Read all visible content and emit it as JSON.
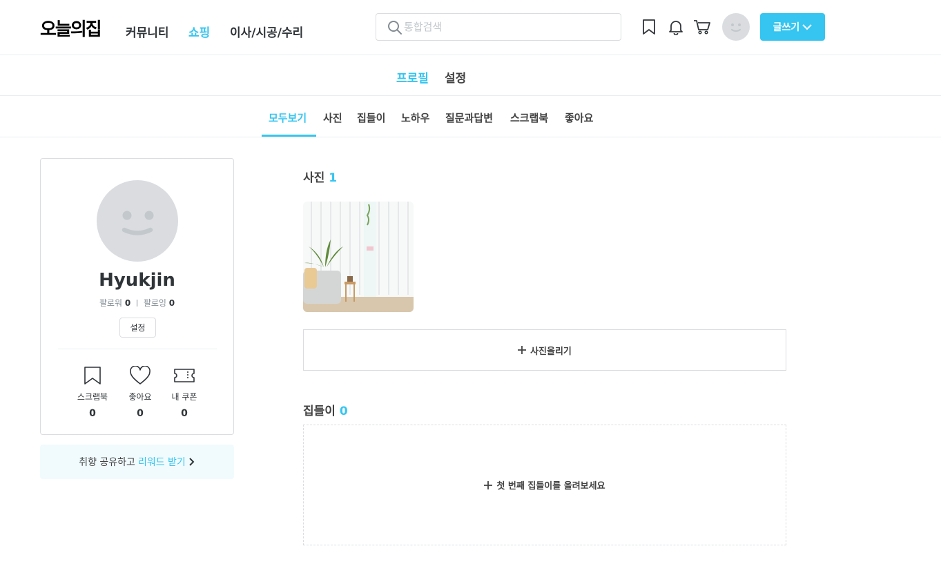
{
  "header": {
    "logo": "오늘의집",
    "nav": [
      {
        "label": "커뮤니티",
        "active": false
      },
      {
        "label": "쇼핑",
        "active": true
      },
      {
        "label": "이사/시공/수리",
        "active": false
      }
    ],
    "search": {
      "placeholder": "통합검색",
      "value": ""
    },
    "icons": [
      "search-icon",
      "bookmark-icon",
      "bell-icon",
      "cart-icon",
      "avatar"
    ],
    "write_button": "글쓰기"
  },
  "profile_nav": {
    "tabs": [
      {
        "label": "프로필",
        "active": true
      },
      {
        "label": "설정",
        "active": false
      }
    ]
  },
  "sub_nav": {
    "tabs": [
      {
        "label": "모두보기",
        "active": true
      },
      {
        "label": "사진",
        "active": false
      },
      {
        "label": "집들이",
        "active": false
      },
      {
        "label": "노하우",
        "active": false
      },
      {
        "label": "질문과답변",
        "active": false
      },
      {
        "label": "스크랩북",
        "active": false
      },
      {
        "label": "좋아요",
        "active": false
      }
    ]
  },
  "profile": {
    "username": "Hyukjin",
    "follower_label": "팔로워",
    "follower_count": "0",
    "following_label": "팔로잉",
    "following_count": "0",
    "settings_button": "설정",
    "stats": [
      {
        "label": "스크랩북",
        "value": "0",
        "icon": "bookmark-icon"
      },
      {
        "label": "좋아요",
        "value": "0",
        "icon": "heart-icon"
      },
      {
        "label": "내 쿠폰",
        "value": "0",
        "icon": "coupon-icon"
      }
    ]
  },
  "reward_banner": {
    "text": "취향 공유하고",
    "highlight": "리워드 받기"
  },
  "content": {
    "photos": {
      "title": "사진",
      "count": "1",
      "upload_button": "사진올리기"
    },
    "houses": {
      "title": "집들이",
      "count": "0",
      "empty_cta": "첫 번째 집들이를 올려보세요"
    }
  },
  "colors": {
    "accent": "#35c5f0",
    "text": "#2f3438",
    "border": "#dadce0"
  }
}
